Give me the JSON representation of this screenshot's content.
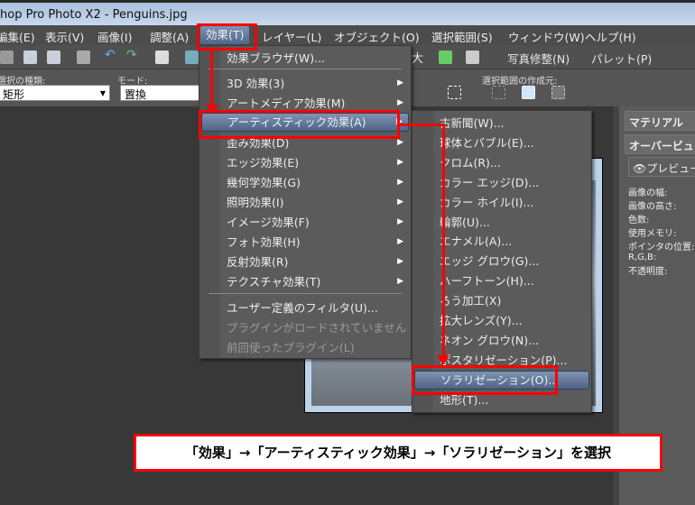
{
  "window": {
    "title": "hop Pro Photo X2 - Penguins.jpg"
  },
  "menubar": [
    "編集(E)",
    "表示(V)",
    "画像(I)",
    "調整(A)",
    "効果(T)",
    "レイヤー(L)",
    "オブジェクト(O)",
    "選択範囲(S)",
    "ウィンドウ(W)",
    "ヘルプ(H)"
  ],
  "toolbar": {
    "zoom_partial": "大",
    "photo_fix": "写真修整(N)",
    "palette": "パレット(P)"
  },
  "options": {
    "selection_type_label": "選択の種類:",
    "selection_type_value": "矩形",
    "mode_label": "モード:",
    "mode_value": "置換",
    "create_from_label": "選択範囲の作成元:"
  },
  "effects_menu": {
    "items": [
      {
        "label": "効果ブラウザ(W)...",
        "submenu": false
      },
      {
        "label": "3D 効果(3)",
        "submenu": true
      },
      {
        "label": "アートメディア効果(M)",
        "submenu": true
      },
      {
        "label": "アーティスティック効果(A)",
        "submenu": true,
        "highlighted": true
      },
      {
        "label": "歪み効果(D)",
        "submenu": true
      },
      {
        "label": "エッジ効果(E)",
        "submenu": true
      },
      {
        "label": "幾何学効果(G)",
        "submenu": true
      },
      {
        "label": "照明効果(I)",
        "submenu": true
      },
      {
        "label": "イメージ効果(F)",
        "submenu": true
      },
      {
        "label": "フォト効果(H)",
        "submenu": true
      },
      {
        "label": "反射効果(R)",
        "submenu": true
      },
      {
        "label": "テクスチャ効果(T)",
        "submenu": true
      },
      {
        "label": "ユーザー定義のフィルタ(U)...",
        "submenu": false
      },
      {
        "label": "プラグインがロードされていません",
        "disabled": true
      },
      {
        "label": "前回使ったプラグイン(L)",
        "disabled": true
      }
    ]
  },
  "artistic_submenu": {
    "items": [
      "古新聞(W)...",
      "球体とバブル(E)...",
      "クロム(R)...",
      "カラー エッジ(D)...",
      "カラー ホイル(I)...",
      "輪郭(U)...",
      "エナメル(A)...",
      "エッジ グロウ(G)...",
      "ハーフトーン(H)...",
      "ろう加工(X)",
      "拡大レンズ(Y)...",
      "ネオン グロウ(N)...",
      "ポスタリゼーション(P)...",
      "ソラリゼーション(O)...",
      "地形(T)..."
    ],
    "highlighted_index": 13
  },
  "right_panel": {
    "tabs": [
      "マテリアル",
      "オーバービュー",
      "プレビュー"
    ],
    "info_labels": [
      "画像の幅:",
      "画像の高さ:",
      "色数:",
      "使用メモリ:",
      "ポインタの位置:",
      "R,G,B:",
      "不透明度:"
    ]
  },
  "caption": "「効果」→「アーティスティック効果」→「ソラリゼーション」を選択",
  "colors": {
    "annotation": "#ff0000",
    "highlight": "#5c7296"
  }
}
